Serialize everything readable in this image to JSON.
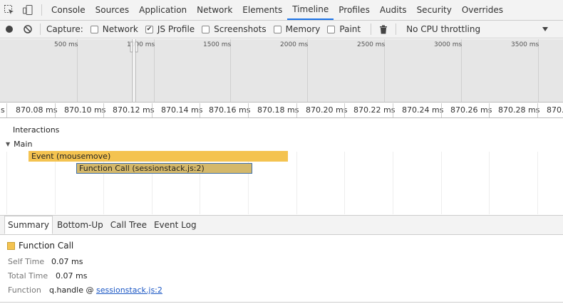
{
  "tabs": [
    {
      "label": "Console"
    },
    {
      "label": "Sources"
    },
    {
      "label": "Application"
    },
    {
      "label": "Network"
    },
    {
      "label": "Elements"
    },
    {
      "label": "Timeline"
    },
    {
      "label": "Profiles"
    },
    {
      "label": "Audits"
    },
    {
      "label": "Security"
    },
    {
      "label": "Overrides"
    }
  ],
  "active_tab": "Timeline",
  "toolbar": {
    "capture_label": "Capture:",
    "options": [
      {
        "label": "Network",
        "checked": false
      },
      {
        "label": "JS Profile",
        "checked": true
      },
      {
        "label": "Screenshots",
        "checked": false
      },
      {
        "label": "Memory",
        "checked": false
      },
      {
        "label": "Paint",
        "checked": false
      }
    ],
    "throttling": "No CPU throttling"
  },
  "overview": {
    "ticks": [
      "500 ms",
      "1000 ms",
      "1500 ms",
      "2000 ms",
      "2500 ms",
      "3000 ms",
      "3500 ms"
    ]
  },
  "ruler": {
    "ticks": [
      "s",
      "870.08 ms",
      "870.10 ms",
      "870.12 ms",
      "870.14 ms",
      "870.16 ms",
      "870.18 ms",
      "870.20 ms",
      "870.22 ms",
      "870.24 ms",
      "870.26 ms",
      "870.28 ms",
      "870."
    ]
  },
  "flame": {
    "interactions_label": "Interactions",
    "main_label": "Main",
    "event_label": "Event (mousemove)",
    "function_label": "Function Call (sessionstack.js:2)"
  },
  "bottom_tabs": [
    {
      "label": "Summary"
    },
    {
      "label": "Bottom-Up"
    },
    {
      "label": "Call Tree"
    },
    {
      "label": "Event Log"
    }
  ],
  "summary": {
    "title": "Function Call",
    "self_time_label": "Self Time",
    "self_time_value": "0.07 ms",
    "total_time_label": "Total Time",
    "total_time_value": "0.07 ms",
    "function_label": "Function",
    "function_prefix": "q.handle @ ",
    "function_link": "sessionstack.js:2"
  },
  "colors": {
    "event": "#f4c350",
    "function_call": "#d4b86a",
    "selection_border": "#3f6fa8",
    "active_tab_underline": "#1a73e8",
    "link": "#1a56c4"
  }
}
